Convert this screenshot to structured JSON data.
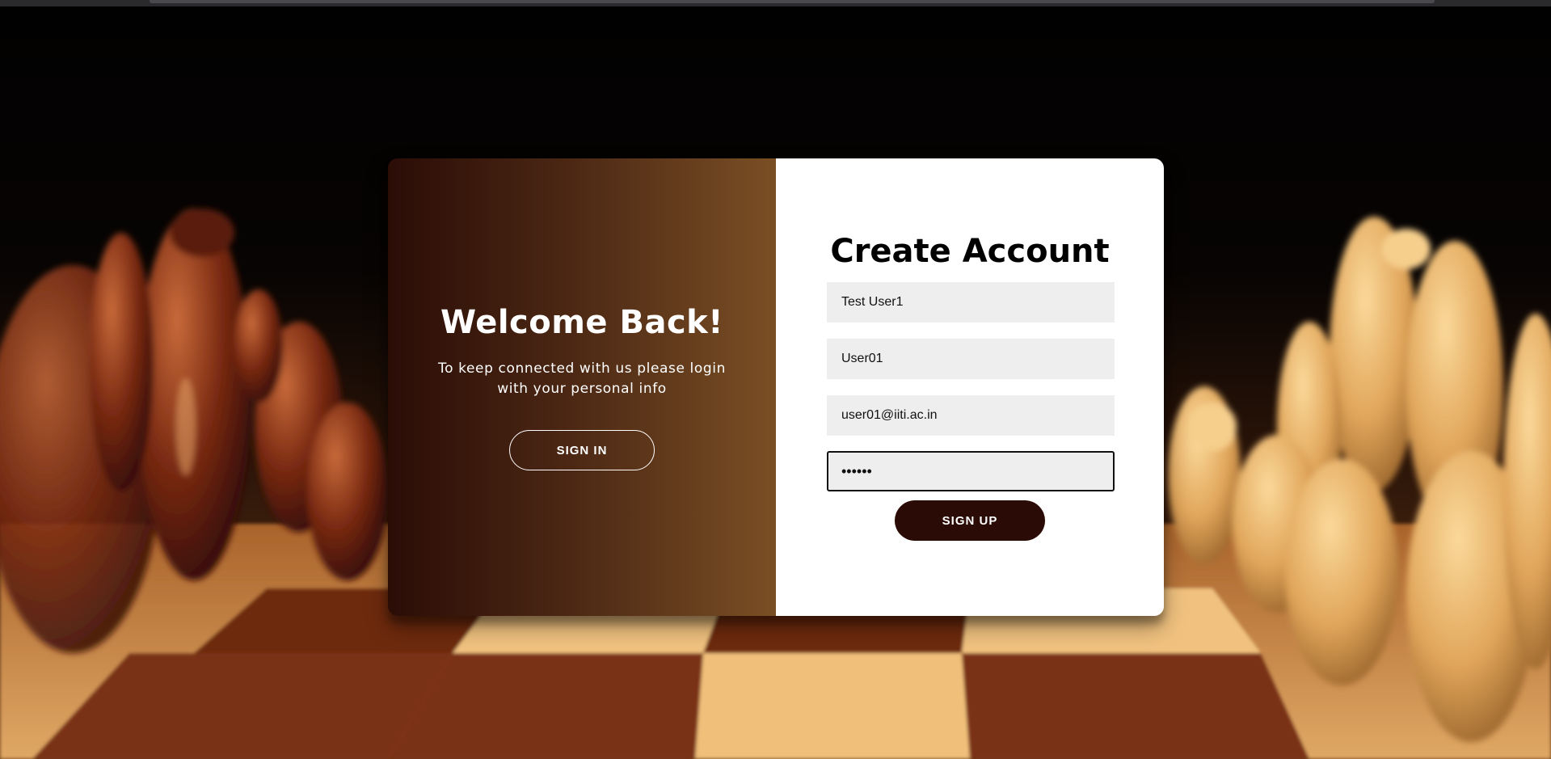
{
  "overlay": {
    "title": "Welcome Back!",
    "message": "To keep connected with us please login with your personal info",
    "signin_label": "SIGN IN"
  },
  "signup_form": {
    "title": "Create Account",
    "name_value": "Test User1",
    "username_value": "User01",
    "email_value": "user01@iiti.ac.in",
    "password_value": "••••••",
    "signup_label": "SIGN UP"
  },
  "colors": {
    "gradient_dark": "#2b0d07",
    "gradient_light": "#7a4f25",
    "button_dark": "#2a0b05",
    "input_background": "#eeeeee"
  }
}
